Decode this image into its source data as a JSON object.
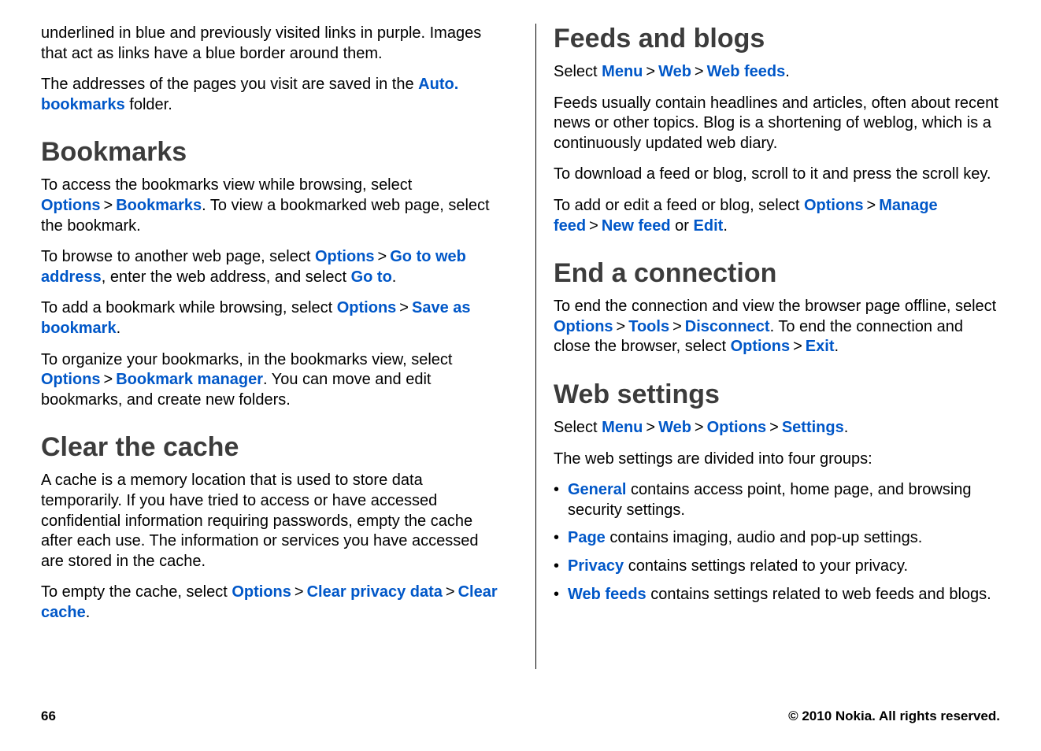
{
  "left": {
    "intro1": "underlined in blue and previously visited links in purple. Images that act as links have a blue border around them.",
    "intro2_pre": "The addresses of the pages you visit are saved in the ",
    "intro2_link": "Auto. bookmarks",
    "intro2_post": " folder.",
    "bookmarks_title": "Bookmarks",
    "bm_p1_a": "To access the bookmarks view while browsing, select ",
    "bm_p1_opt": "Options",
    "bm_p1_bookmarks": "Bookmarks",
    "bm_p1_b": ". To view a bookmarked web page, select the bookmark.",
    "bm_p2_a": "To browse to another web page, select ",
    "bm_p2_opt": "Options",
    "bm_p2_go": "Go to web address",
    "bm_p2_b": ", enter the web address, and select ",
    "bm_p2_goto": "Go to",
    "bm_p2_c": ".",
    "bm_p3_a": "To add a bookmark while browsing, select ",
    "bm_p3_opt": "Options",
    "bm_p3_save": "Save as bookmark",
    "bm_p3_b": ".",
    "bm_p4_a": "To organize your bookmarks, in the bookmarks view, select ",
    "bm_p4_opt": "Options",
    "bm_p4_mgr": "Bookmark manager",
    "bm_p4_b": ". You can move and edit bookmarks, and create new folders.",
    "cache_title": "Clear the cache",
    "cache_p1": "A cache is a memory location that is used to store data temporarily. If you have tried to access or have accessed confidential information requiring passwords, empty the cache after each use. The information or services you have accessed are stored in the cache.",
    "cache_p2_a": "To empty the cache, select ",
    "cache_p2_opt": "Options",
    "cache_p2_clear": "Clear privacy data",
    "cache_p2_cache": "Clear cache",
    "cache_p2_b": "."
  },
  "right": {
    "feeds_title": "Feeds and blogs",
    "feeds_sel_a": "Select ",
    "feeds_menu": "Menu",
    "feeds_web": "Web",
    "feeds_webfeeds": "Web feeds",
    "feeds_sel_b": ".",
    "feeds_p1": "Feeds usually contain headlines and articles, often about recent news or other topics. Blog is a shortening of weblog, which is a continuously updated web diary.",
    "feeds_p2": "To download a feed or blog, scroll to it and press the scroll key.",
    "feeds_p3_a": "To add or edit a feed or blog, select ",
    "feeds_p3_opt": "Options",
    "feeds_p3_manage": "Manage feed",
    "feeds_p3_new": "New feed",
    "feeds_p3_or": " or ",
    "feeds_p3_edit": "Edit",
    "feeds_p3_b": ".",
    "end_title": "End a connection",
    "end_p_a": "To end the connection and view the browser page offline, select ",
    "end_opt": "Options",
    "end_tools": "Tools",
    "end_disc": "Disconnect",
    "end_p_b": ". To end the connection and close the browser, select ",
    "end_opt2": "Options",
    "end_exit": "Exit",
    "end_p_c": ".",
    "ws_title": "Web settings",
    "ws_sel_a": "Select ",
    "ws_menu": "Menu",
    "ws_web": "Web",
    "ws_opt": "Options",
    "ws_settings": "Settings",
    "ws_sel_b": ".",
    "ws_p1": "The web settings are divided into four groups:",
    "ws_li1_link": "General",
    "ws_li1_rest": " contains access point, home page, and browsing security settings.",
    "ws_li2_link": "Page",
    "ws_li2_rest": " contains imaging, audio and pop-up settings.",
    "ws_li3_link": "Privacy",
    "ws_li3_rest": " contains settings related to your privacy.",
    "ws_li4_link": "Web feeds",
    "ws_li4_rest": " contains settings related to web feeds and blogs."
  },
  "footer": {
    "page": "66",
    "copyright": "© 2010 Nokia. All rights reserved."
  },
  "gt": ">"
}
